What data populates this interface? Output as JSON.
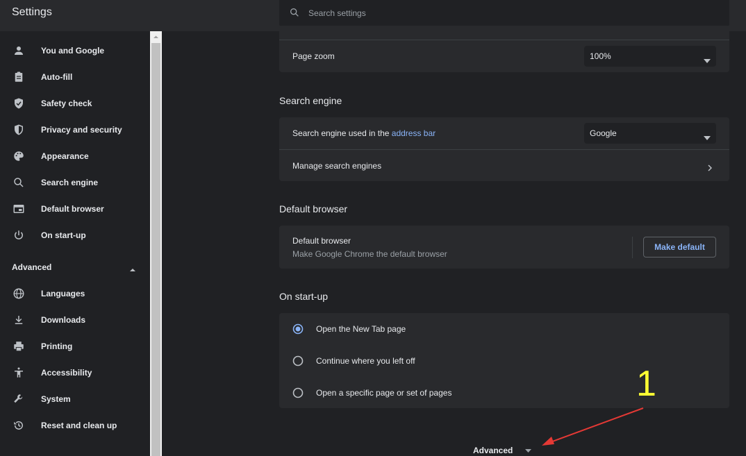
{
  "app": {
    "title": "Settings"
  },
  "search": {
    "placeholder": "Search settings"
  },
  "sidebar": {
    "items": [
      {
        "label": "You and Google",
        "icon": "person-icon"
      },
      {
        "label": "Auto-fill",
        "icon": "clipboard-icon"
      },
      {
        "label": "Safety check",
        "icon": "shield-check-icon"
      },
      {
        "label": "Privacy and security",
        "icon": "shield-icon"
      },
      {
        "label": "Appearance",
        "icon": "palette-icon"
      },
      {
        "label": "Search engine",
        "icon": "search-icon"
      },
      {
        "label": "Default browser",
        "icon": "browser-window-icon"
      },
      {
        "label": "On start-up",
        "icon": "power-icon"
      }
    ],
    "advanced_label": "Advanced",
    "advanced_items": [
      {
        "label": "Languages",
        "icon": "globe-icon"
      },
      {
        "label": "Downloads",
        "icon": "download-icon"
      },
      {
        "label": "Printing",
        "icon": "printer-icon"
      },
      {
        "label": "Accessibility",
        "icon": "accessibility-icon"
      },
      {
        "label": "System",
        "icon": "wrench-icon"
      },
      {
        "label": "Reset and clean up",
        "icon": "history-icon"
      }
    ]
  },
  "appearance": {
    "page_zoom_label": "Page zoom",
    "page_zoom_value": "100%"
  },
  "search_engine": {
    "title": "Search engine",
    "used_label_prefix": "Search engine used in the",
    "used_label_link": "address bar",
    "selected_value": "Google",
    "manage_label": "Manage search engines"
  },
  "default_browser": {
    "title": "Default browser",
    "heading": "Default browser",
    "description": "Make Google Chrome the default browser",
    "button_label": "Make default"
  },
  "startup": {
    "title": "On start-up",
    "options": [
      {
        "label": "Open the New Tab page",
        "selected": true
      },
      {
        "label": "Continue where you left off",
        "selected": false
      },
      {
        "label": "Open a specific page or set of pages",
        "selected": false
      }
    ]
  },
  "bottom": {
    "advanced_label": "Advanced"
  },
  "annotation": {
    "number": "1",
    "color": "#ffff33",
    "arrow_color": "#e53935"
  },
  "colors": {
    "accent": "#8ab4f8",
    "background": "#202124",
    "card": "#292a2d"
  }
}
